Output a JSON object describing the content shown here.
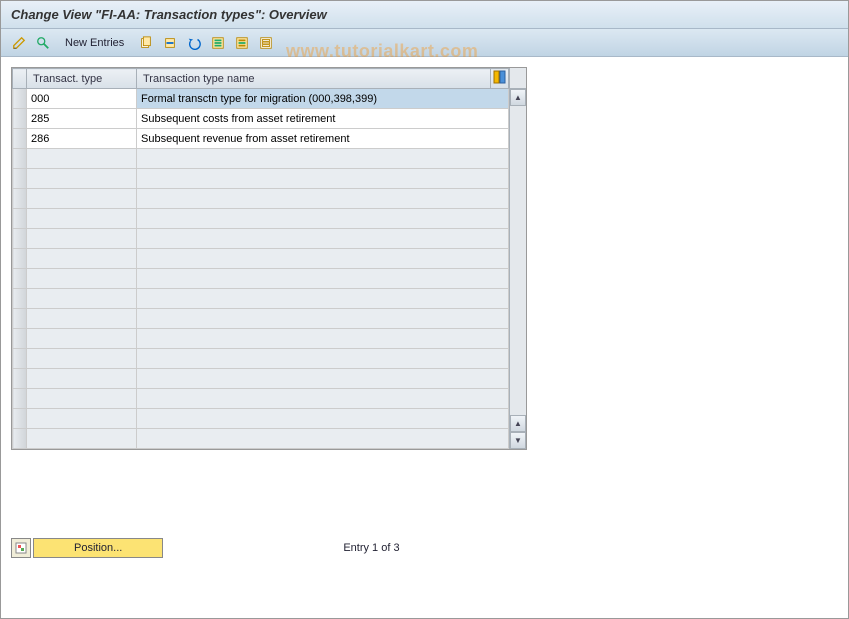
{
  "title": "Change View \"FI-AA: Transaction types\": Overview",
  "toolbar": {
    "new_entries_label": "New Entries",
    "icons": {
      "toggle": "toggle-display-change",
      "detail": "detail-view",
      "copy": "copy",
      "delete": "delete",
      "undo": "undo-change",
      "select_all": "select-all",
      "select_block": "select-block",
      "deselect_all": "deselect-all"
    }
  },
  "table": {
    "headers": {
      "col1": "Transact. type",
      "col2": "Transaction type name"
    },
    "rows": [
      {
        "code": "000",
        "name": "Formal transctn type for migration (000,398,399)",
        "highlight": true
      },
      {
        "code": "285",
        "name": "Subsequent costs from asset retirement",
        "highlight": false
      },
      {
        "code": "286",
        "name": "Subsequent revenue from asset retirement",
        "highlight": false
      }
    ],
    "empty_row_count": 15
  },
  "footer": {
    "position_label": "Position...",
    "entry_text": "Entry 1 of 3"
  },
  "watermark": "www.tutorialkart.com"
}
